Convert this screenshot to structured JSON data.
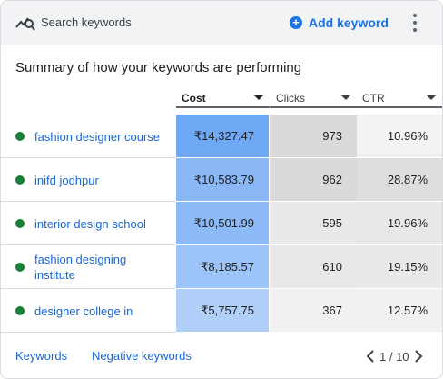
{
  "header": {
    "search_label": "Search keywords",
    "add_label": "Add keyword",
    "accent_color": "#1a73e8"
  },
  "title": "Summary of how your keywords are performing",
  "columns": [
    {
      "label": "Cost",
      "active": true
    },
    {
      "label": "Clicks",
      "active": false
    },
    {
      "label": "CTR",
      "active": false
    }
  ],
  "rows": [
    {
      "keyword": "fashion designer course",
      "cost": "₹14,327.47",
      "clicks": "973",
      "ctr": "10.96%",
      "status_color": "#188038",
      "cost_shade": "#6fa8f5",
      "clicks_shade": "#d9d9d9",
      "ctr_shade": "#f3f3f3"
    },
    {
      "keyword": "inifd jodhpur",
      "cost": "₹10,583.79",
      "clicks": "962",
      "ctr": "28.87%",
      "status_color": "#188038",
      "cost_shade": "#8ab8f7",
      "clicks_shade": "#dadada",
      "ctr_shade": "#dedede"
    },
    {
      "keyword": "interior design school",
      "cost": "₹10,501.99",
      "clicks": "595",
      "ctr": "19.96%",
      "status_color": "#188038",
      "cost_shade": "#8cb9f7",
      "clicks_shade": "#e9e9e9",
      "ctr_shade": "#e8e8e8"
    },
    {
      "keyword": "fashion designing institute",
      "cost": "₹8,185.57",
      "clicks": "610",
      "ctr": "19.15%",
      "status_color": "#188038",
      "cost_shade": "#9dc4f8",
      "clicks_shade": "#e8e8e8",
      "ctr_shade": "#e9e9e9"
    },
    {
      "keyword": "designer college in",
      "cost": "₹5,757.75",
      "clicks": "367",
      "ctr": "12.57%",
      "status_color": "#188038",
      "cost_shade": "#b0cff9",
      "clicks_shade": "#f1f1f1",
      "ctr_shade": "#f1f1f1"
    }
  ],
  "footer": {
    "keywords_link": "Keywords",
    "negative_link": "Negative keywords",
    "page_indicator": "1 / 10"
  }
}
